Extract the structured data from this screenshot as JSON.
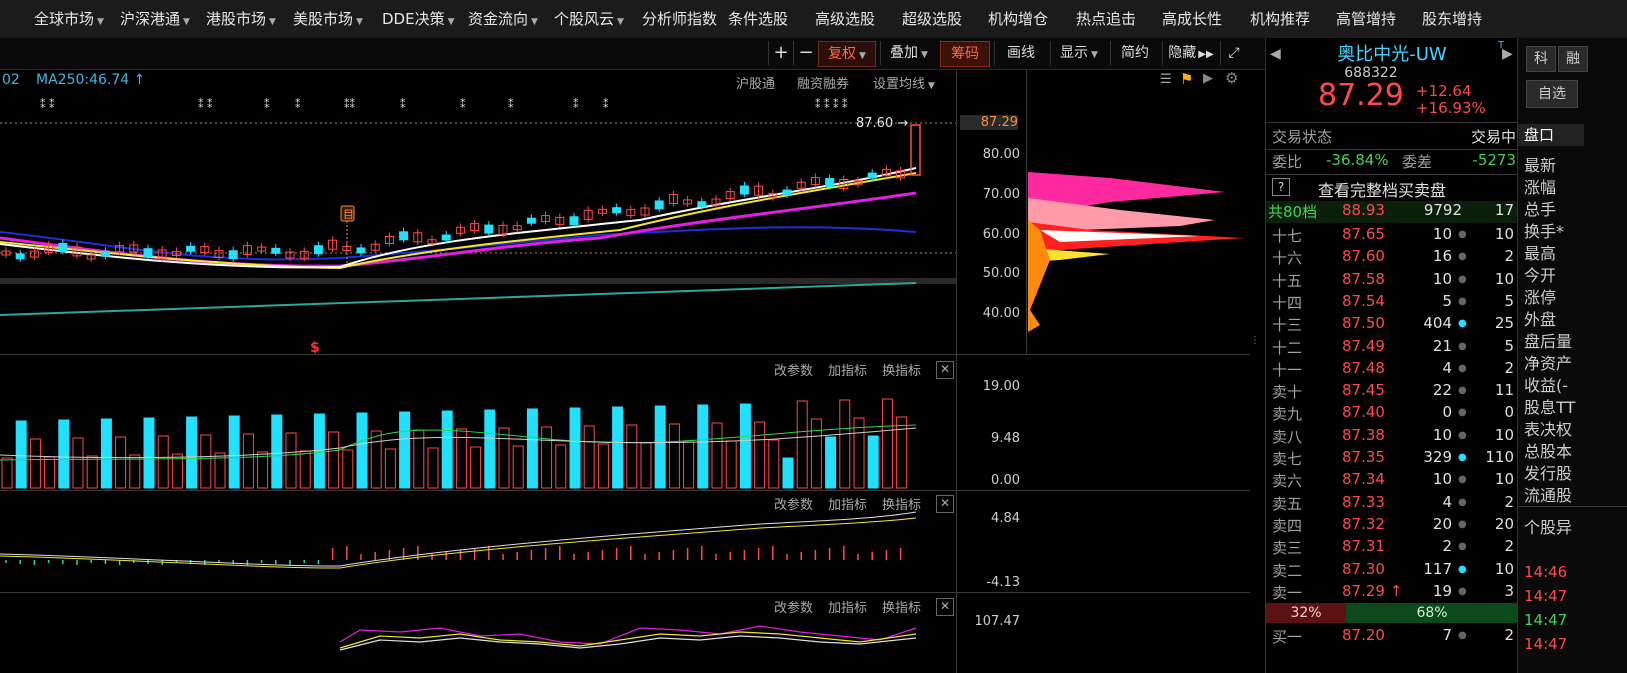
{
  "menu": [
    {
      "label": "全球市场",
      "caret": true
    },
    {
      "label": "沪深港通",
      "caret": true
    },
    {
      "label": "港股市场",
      "caret": true
    },
    {
      "label": "美股市场",
      "caret": true
    },
    {
      "label": "DDE决策",
      "caret": true
    },
    {
      "label": "资金流向",
      "caret": true
    },
    {
      "label": "个股风云",
      "caret": true
    },
    {
      "label": "分析师指数",
      "caret": false
    },
    {
      "label": "条件选股",
      "caret": false
    },
    {
      "label": "高级选股",
      "caret": false
    },
    {
      "label": "超级选股",
      "caret": false
    },
    {
      "label": "机构增仓",
      "caret": false
    },
    {
      "label": "热点追击",
      "caret": false
    },
    {
      "label": "高成长性",
      "caret": false
    },
    {
      "label": "机构推荐",
      "caret": false
    },
    {
      "label": "高管增持",
      "caret": false
    },
    {
      "label": "股东增持",
      "caret": false
    }
  ],
  "toolbar": {
    "plus": "+",
    "minus": "−",
    "fuquan": "复权",
    "diejia": "叠加",
    "chouma": "筹码",
    "huaxian": "画线",
    "xianshi": "显示",
    "jianyue": "简约",
    "yincang": "隐藏"
  },
  "main_chart": {
    "ma_label": "MA250:46.74",
    "ma_prefix": "02",
    "links": [
      "沪股通",
      "融资融券",
      "设置均线"
    ],
    "price_marker": "87.60",
    "marker_glyph": "目",
    "dollar_glyph": "$",
    "y_axis": [
      "87.29",
      "80.00",
      "70.00",
      "60.00",
      "50.00",
      "40.00"
    ]
  },
  "volume_panel": {
    "buttons": [
      "改参数",
      "加指标",
      "换指标"
    ],
    "y_axis": [
      "19.00",
      "9.48",
      "0.00"
    ]
  },
  "macd_panel": {
    "buttons": [
      "改参数",
      "加指标",
      "换指标"
    ],
    "y_axis": [
      "4.84",
      "-4.13"
    ]
  },
  "kdj_panel": {
    "buttons": [
      "改参数",
      "加指标",
      "换指标"
    ],
    "y_axis": [
      "107.47"
    ]
  },
  "quote": {
    "name": "奥比中光-UW",
    "code": "688322",
    "price": "87.29",
    "change": "+12.64",
    "pct": "+16.93%",
    "status_label": "交易状态",
    "status_value": "交易中",
    "weibi_label": "委比",
    "weibi_value": "-36.84%",
    "weicha_label": "委差",
    "weicha_value": "-5273",
    "full_book": "查看完整档买卖盘",
    "total_label": "共80档",
    "total_price": "88.93",
    "total_vol": "9792",
    "total_cnt": "17",
    "asks": [
      {
        "label": "十七",
        "price": "87.65",
        "vol": "10",
        "dot": "grey",
        "cnt": "10"
      },
      {
        "label": "十六",
        "price": "87.60",
        "vol": "16",
        "dot": "grey",
        "cnt": "2"
      },
      {
        "label": "十五",
        "price": "87.58",
        "vol": "10",
        "dot": "grey",
        "cnt": "10"
      },
      {
        "label": "十四",
        "price": "87.54",
        "vol": "5",
        "dot": "grey",
        "cnt": "5"
      },
      {
        "label": "十三",
        "price": "87.50",
        "vol": "404",
        "dot": "cyan",
        "cnt": "25"
      },
      {
        "label": "十二",
        "price": "87.49",
        "vol": "21",
        "dot": "grey",
        "cnt": "5"
      },
      {
        "label": "十一",
        "price": "87.48",
        "vol": "4",
        "dot": "grey",
        "cnt": "2"
      },
      {
        "label": "卖十",
        "price": "87.45",
        "vol": "22",
        "dot": "grey",
        "cnt": "11"
      },
      {
        "label": "卖九",
        "price": "87.40",
        "vol": "0",
        "dot": "grey",
        "cnt": "0"
      },
      {
        "label": "卖八",
        "price": "87.38",
        "vol": "10",
        "dot": "grey",
        "cnt": "10"
      },
      {
        "label": "卖七",
        "price": "87.35",
        "vol": "329",
        "dot": "cyan",
        "cnt": "110"
      },
      {
        "label": "卖六",
        "price": "87.34",
        "vol": "10",
        "dot": "grey",
        "cnt": "10"
      },
      {
        "label": "卖五",
        "price": "87.33",
        "vol": "4",
        "dot": "grey",
        "cnt": "2"
      },
      {
        "label": "卖四",
        "price": "87.32",
        "vol": "20",
        "dot": "grey",
        "cnt": "20"
      },
      {
        "label": "卖三",
        "price": "87.31",
        "vol": "2",
        "dot": "grey",
        "cnt": "2"
      },
      {
        "label": "卖二",
        "price": "87.30",
        "vol": "117",
        "dot": "cyan",
        "cnt": "10"
      },
      {
        "label": "卖一",
        "price": "87.29",
        "vol": "19",
        "dot": "grey",
        "cnt": "3",
        "arrow": "↑"
      }
    ],
    "bar_left": "32%",
    "bar_right": "68%",
    "bid1": {
      "label": "买一",
      "price": "87.20",
      "vol": "7",
      "dot": "grey",
      "cnt": "2"
    }
  },
  "side": {
    "btn1": "科",
    "btn2": "融",
    "zixuan": "自选",
    "pankou": "盘口",
    "items": [
      "最新",
      "涨幅",
      "总手",
      "换手*",
      "最高",
      "今开",
      "涨停",
      "外盘",
      "盘后量",
      "净资产",
      "收益(-",
      "股息TT",
      "表决权",
      "总股本",
      "发行股",
      "流通股"
    ],
    "gegu": "个股异",
    "times": [
      {
        "t": "14:46",
        "c": "#ff4a4a"
      },
      {
        "t": "14:47",
        "c": "#ff4a4a"
      },
      {
        "t": "14:47",
        "c": "#3fd45a"
      },
      {
        "t": "14:47",
        "c": "#ff4a4a"
      }
    ]
  },
  "colors": {
    "up": "#ff4a4a",
    "down": "#3fd45a",
    "accent": "#ff6a3d",
    "cyan": "#22e0ff"
  }
}
